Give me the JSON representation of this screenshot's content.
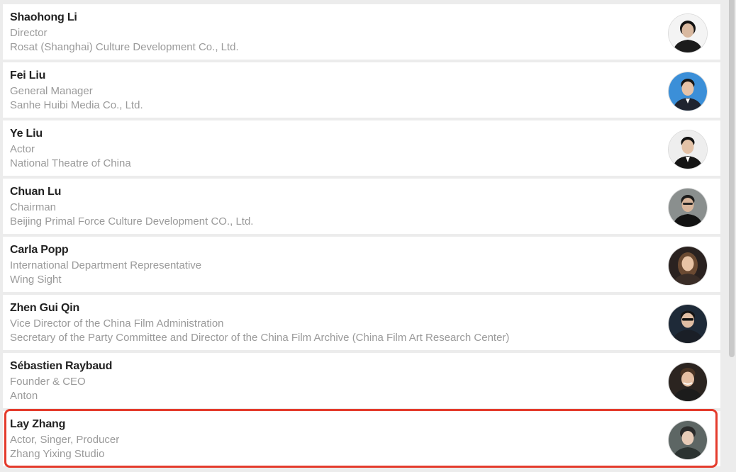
{
  "people": [
    {
      "name": "Shaohong Li",
      "title": "Director",
      "org": "Rosat (Shanghai) Culture Development Co., Ltd.",
      "avatar_bg": "#f4f4f4",
      "avatar_body": "#1b1b1b",
      "avatar_skin": "#d9b9a0",
      "avatar_hair": "#111111"
    },
    {
      "name": "Fei Liu",
      "title": "General Manager",
      "org": "Sanhe Huibi Media Co., Ltd.",
      "avatar_bg": "#3b8fd8",
      "avatar_body": "#1f2430",
      "avatar_skin": "#e6c3a8",
      "avatar_hair": "#161616"
    },
    {
      "name": "Ye Liu",
      "title": "Actor",
      "org": "National Theatre of China",
      "avatar_bg": "#eeeeee",
      "avatar_body": "#141414",
      "avatar_skin": "#e3c2a7",
      "avatar_hair": "#111111"
    },
    {
      "name": "Chuan Lu",
      "title": "Chairman",
      "org": "Beijing Primal Force Culture Development CO., Ltd.",
      "avatar_bg": "#8a8f8e",
      "avatar_body": "#121212",
      "avatar_skin": "#d8b59b",
      "avatar_hair": "#1a1a1a"
    },
    {
      "name": "Carla Popp",
      "title": "International Department Representative",
      "org": "Wing Sight",
      "avatar_bg": "#2a2220",
      "avatar_body": "#3a2d27",
      "avatar_skin": "#e8c3a5",
      "avatar_hair": "#6b4a32"
    },
    {
      "name": "Zhen Gui Qin",
      "title": "Vice Director of the China Film Administration",
      "org": "Secretary of the Party Committee and Director of the China Film Archive (China Film Art Research Center)",
      "avatar_bg": "#1e2a38",
      "avatar_body": "#1a1f27",
      "avatar_skin": "#e0bea4",
      "avatar_hair": "#141414"
    },
    {
      "name": "Sébastien Raybaud",
      "title": "Founder & CEO",
      "org": "Anton",
      "avatar_bg": "#2b2420",
      "avatar_body": "#1c1c1c",
      "avatar_skin": "#e5bfa3",
      "avatar_hair": "#4a3424"
    },
    {
      "name": "Lay Zhang",
      "title": "Actor, Singer, Producer",
      "org": "Zhang Yixing Studio",
      "avatar_bg": "#5d6664",
      "avatar_body": "#2c3331",
      "avatar_skin": "#e7cbb7",
      "avatar_hair": "#2a2a2a"
    }
  ],
  "highlight_color": "#e43b2c"
}
